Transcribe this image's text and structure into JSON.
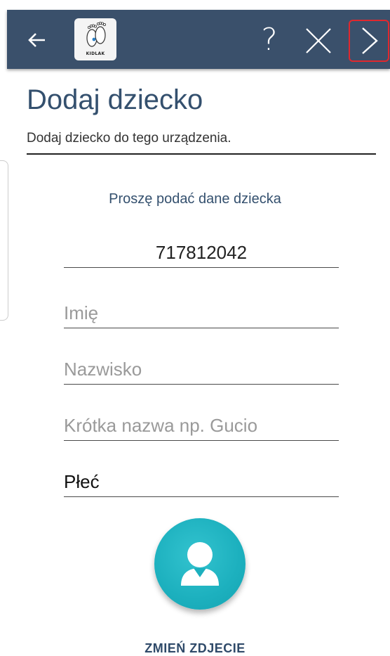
{
  "toolbar": {
    "back_icon": "arrow-left-icon",
    "logo_text": "KIDLAK",
    "help_label": "?",
    "close_icon": "close-icon",
    "next_icon": "chevron-right-icon",
    "background_color": "#3a506b",
    "highlight_color": "#e0282e"
  },
  "header": {
    "title": "Dodaj dziecko",
    "subtitle": "Dodaj dziecko do tego urządzenia."
  },
  "form": {
    "prompt": "Proszę podać dane dziecka",
    "phone_value": "717812042",
    "first_name_placeholder": "Imię",
    "last_name_placeholder": "Nazwisko",
    "nickname_placeholder": "Krótka nazwa np. Gucio",
    "gender_label": "Płeć"
  },
  "photo": {
    "icon": "person-avatar-icon",
    "button_color": "#1cb0be",
    "change_label": "ZMIEŃ ZDJECIE"
  }
}
